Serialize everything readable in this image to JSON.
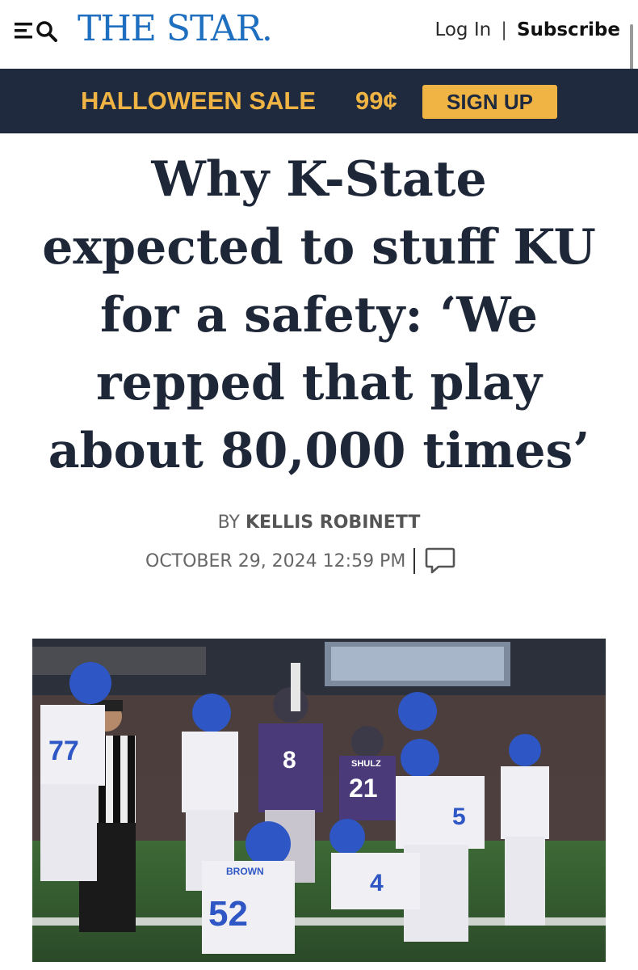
{
  "header": {
    "logo": "THE STAR.",
    "login_label": "Log In",
    "separator": "|",
    "subscribe_label": "Subscribe",
    "icons": [
      "menu-icon",
      "search-icon"
    ]
  },
  "promo": {
    "sale_text": "HALLOWEEN SALE",
    "price": "99¢",
    "cta_label": "SIGN UP",
    "colors": {
      "background": "#1f2a3f",
      "accent": "#f0b444"
    }
  },
  "article": {
    "headline_lines": [
      "Why K-State",
      "expected to stuff KU",
      "for a safety: ‘We",
      "repped that play",
      "about 80,000 times’"
    ],
    "byline_prefix": "BY",
    "author": "KELLIS ROBINETT",
    "date": "OCTOBER 29, 2024 12:59 PM",
    "comment_icon": "comment-icon"
  },
  "photo": {
    "jersey_numbers": [
      "77",
      "8",
      "21",
      "52",
      "4",
      "5"
    ],
    "jersey_names": [
      "BROWN",
      "SHULZ"
    ]
  }
}
